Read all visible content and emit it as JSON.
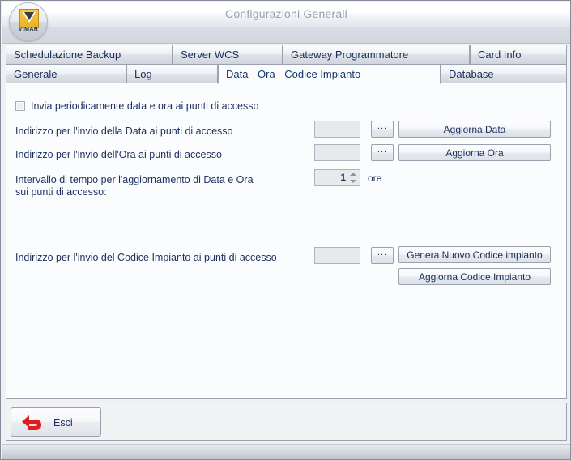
{
  "window": {
    "title": "Configurazioni Generali",
    "logo_word": "VIMAR"
  },
  "tabs": {
    "row1": [
      {
        "label": "Schedulazione Backup",
        "active": false
      },
      {
        "label": "Server WCS",
        "active": false
      },
      {
        "label": "Gateway Programmatore",
        "active": false
      },
      {
        "label": "Card Info",
        "active": false
      }
    ],
    "row2": [
      {
        "label": "Generale",
        "active": false
      },
      {
        "label": "Log",
        "active": false
      },
      {
        "label": "Data - Ora - Codice Impianto",
        "active": true
      },
      {
        "label": "Database",
        "active": false
      }
    ]
  },
  "form": {
    "periodic_checkbox_label": "Invia periodicamente data e ora ai punti di accesso",
    "periodic_checkbox_checked": false,
    "data_address_label": "Indirizzo per l'invio della Data ai punti di accesso",
    "data_address_value": "",
    "ora_address_label": "Indirizzo per l'invio dell'Ora ai punti di accesso",
    "ora_address_value": "",
    "interval_label_line1": "Intervallo di tempo per l'aggiornamento di Data e Ora",
    "interval_label_line2": "sui punti di accesso:",
    "interval_value": "1",
    "interval_unit": "ore",
    "codice_address_label": "Indirizzo per l'invio del Codice Impianto ai punti di accesso",
    "codice_address_value": "",
    "browse_label": "...",
    "buttons": {
      "aggiorna_data": "Aggiorna Data",
      "aggiorna_ora": "Aggiorna Ora",
      "genera_nuovo_codice": "Genera Nuovo Codice impianto",
      "aggiorna_codice": "Aggiorna Codice Impianto"
    }
  },
  "bottom": {
    "esci_label": "Esci",
    "esci_icon": "back-arrow-icon"
  },
  "colors": {
    "accent_text": "#1b2f5e",
    "title_text": "#9aa0ab",
    "esci_arrow": "#e21b1b",
    "logo_gold": "#eab21f"
  }
}
